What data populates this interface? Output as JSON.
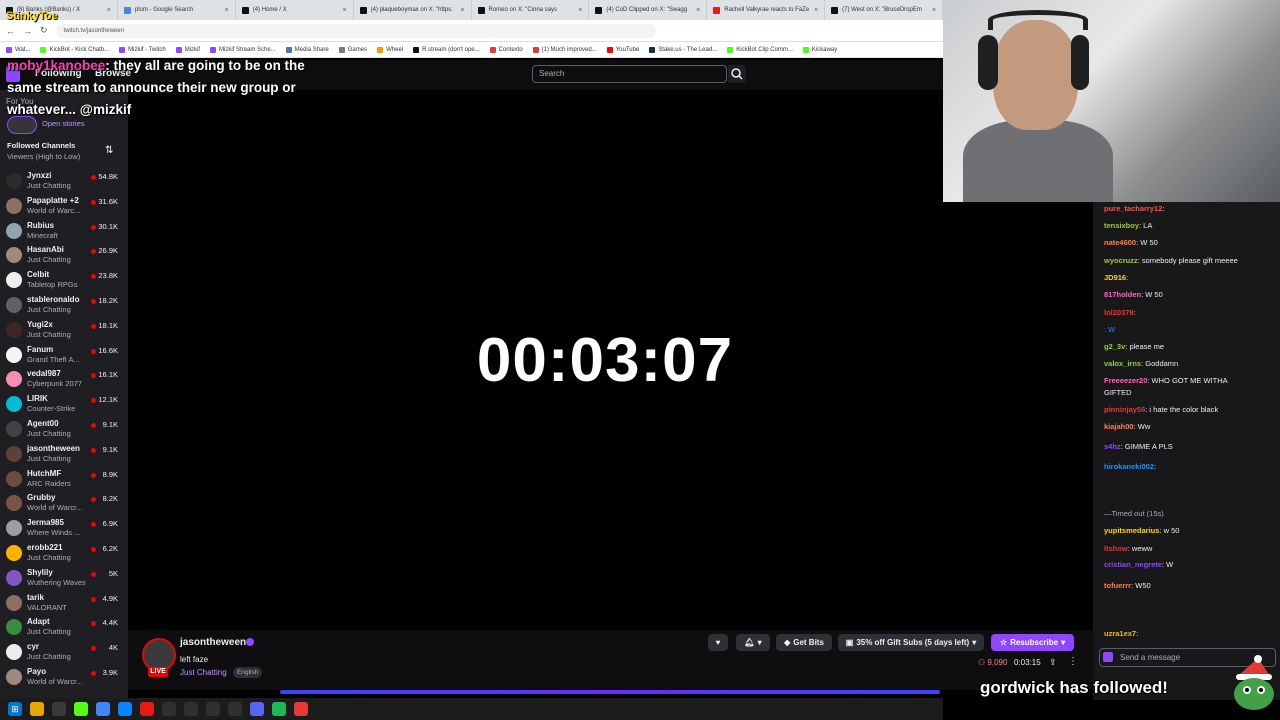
{
  "browser": {
    "tabs": [
      {
        "label": "(8) Banks (@Banks) / X",
        "icon": "x-icon",
        "color": "#111111"
      },
      {
        "label": "plum - Google Search",
        "icon": "google-icon",
        "color": "#4285f4"
      },
      {
        "label": "(4) Home / X",
        "icon": "x-icon",
        "color": "#111111"
      },
      {
        "label": "(4) plaqueboymax on X: \"https:",
        "icon": "x-icon",
        "color": "#111111"
      },
      {
        "label": "Romeo on X: \"Cinna says",
        "icon": "x-icon",
        "color": "#111111"
      },
      {
        "label": "(4) CoD Clipped on X: \"Swagg",
        "icon": "x-icon",
        "color": "#111111"
      },
      {
        "label": "Rachell Valkyrae reacts to FaZe",
        "icon": "video-icon",
        "color": "#e91916"
      },
      {
        "label": "(7) West on X: \"BruceDropEm",
        "icon": "x-icon",
        "color": "#111111"
      }
    ],
    "url": "twitch.tv/jasontheween",
    "bookmarks": [
      {
        "label": "Wat...",
        "color": "#9147ff"
      },
      {
        "label": "KickBot - Kick Chatb...",
        "color": "#53fc18"
      },
      {
        "label": "Mizkif - Twitch",
        "color": "#9147ff"
      },
      {
        "label": "Mizkif",
        "color": "#9147ff"
      },
      {
        "label": "Mizkif Stream Sche...",
        "color": "#9147ff"
      },
      {
        "label": "Media Share",
        "color": "#5c6bc0"
      },
      {
        "label": "Games",
        "color": "#777777"
      },
      {
        "label": "Wheel",
        "color": "#ff9800"
      },
      {
        "label": "R.stream (don't ope...",
        "color": "#111111"
      },
      {
        "label": "Contexto",
        "color": "#e53935"
      },
      {
        "label": "(1) Much improved...",
        "color": "#e53935"
      },
      {
        "label": "YouTube",
        "color": "#ff0000"
      },
      {
        "label": "Stake.us - The Lead...",
        "color": "#1a2c38"
      },
      {
        "label": "KickBot Clip Comm...",
        "color": "#53fc18"
      },
      {
        "label": "Kickaway",
        "color": "#53fc18"
      }
    ]
  },
  "overlay": {
    "streamer_name": "StinkyToe",
    "chat_user": "moby1kanobee",
    "chat_line_1": ": they all are going to be on the",
    "chat_line_2": "same stream to announce their new group or",
    "chat_line_3": "whatever... @mizkif"
  },
  "twitch_nav": {
    "following": "Following",
    "browse": "Browse",
    "search_placeholder": "Search",
    "for_you": "For You"
  },
  "sidebar": {
    "stories": "Open stories",
    "followed_title": "Followed Channels",
    "sort": "Viewers (High to Low)",
    "channels": [
      {
        "name": "Jynxzi",
        "category": "Just Chatting",
        "viewers": "54.8K",
        "color": "#2b2b2b"
      },
      {
        "name": "Papaplatte +2",
        "category": "World of Warc...",
        "viewers": "31.6K",
        "color": "#8d6e63"
      },
      {
        "name": "Rubius",
        "category": "Minecraft",
        "viewers": "30.1K",
        "color": "#90a4ae"
      },
      {
        "name": "HasanAbi",
        "category": "Just Chatting",
        "viewers": "26.9K",
        "color": "#a1887f"
      },
      {
        "name": "Celbit",
        "category": "Tabletop RPGs",
        "viewers": "23.8K",
        "color": "#eeeeee"
      },
      {
        "name": "stableronaldo",
        "category": "Just Chatting",
        "viewers": "18.2K",
        "color": "#616161"
      },
      {
        "name": "Yugi2x",
        "category": "Just Chatting",
        "viewers": "18.1K",
        "color": "#3e2723"
      },
      {
        "name": "Fanum",
        "category": "Grand Theft A...",
        "viewers": "16.6K",
        "color": "#f5f5f5"
      },
      {
        "name": "vedal987",
        "category": "Cyberpunk 2077",
        "viewers": "16.1K",
        "color": "#f48fb1"
      },
      {
        "name": "LIRIK",
        "category": "Counter-Strike",
        "viewers": "12.1K",
        "color": "#00bcd4"
      },
      {
        "name": "Agent00",
        "category": "Just Chatting",
        "viewers": "9.1K",
        "color": "#424242"
      },
      {
        "name": "jasontheween",
        "category": "Just Chatting",
        "viewers": "9.1K",
        "color": "#5d4037"
      },
      {
        "name": "HutchMF",
        "category": "ARC Raiders",
        "viewers": "8.9K",
        "color": "#6d4c41"
      },
      {
        "name": "Grubby",
        "category": "World of Warcr...",
        "viewers": "8.2K",
        "color": "#795548"
      },
      {
        "name": "Jerma985",
        "category": "Where Winds ...",
        "viewers": "6.9K",
        "color": "#9e9e9e"
      },
      {
        "name": "erobb221",
        "category": "Just Chatting",
        "viewers": "6.2K",
        "color": "#ffb300"
      },
      {
        "name": "Shylily",
        "category": "Wuthering Waves",
        "viewers": "5K",
        "color": "#7e57c2"
      },
      {
        "name": "tarik",
        "category": "VALORANT",
        "viewers": "4.9K",
        "color": "#8d6e63"
      },
      {
        "name": "Adapt",
        "category": "Just Chatting",
        "viewers": "4.4K",
        "color": "#388e3c"
      },
      {
        "name": "cyr",
        "category": "Just Chatting",
        "viewers": "4K",
        "color": "#ececec"
      },
      {
        "name": "Payo",
        "category": "World of Warcr...",
        "viewers": "3.9K",
        "color": "#a1887f"
      }
    ]
  },
  "player": {
    "timer": "00:03:07"
  },
  "channel_info": {
    "name": "jasontheween",
    "title": "left faze",
    "category": "Just Chatting",
    "language": "English",
    "live": "LIVE",
    "get_bits": "Get Bits",
    "gift_subs": "35% off Gift Subs (5 days left)",
    "resubscribe": "Resubscribe",
    "viewers": "9,090",
    "uptime": "0:03:15"
  },
  "chat": {
    "input_placeholder": "Send a message",
    "messages": [
      {
        "user": "pure_tacharry12",
        "text": ":",
        "color": "#ff4f4f"
      },
      {
        "user": "tensixboy",
        "text": ": LA",
        "color": "#9acd32"
      },
      {
        "user": "nate4600",
        "text": ": W 50",
        "color": "#ff7f50"
      },
      {
        "user": "wyocruzz",
        "text": ": somebody please gift meeee",
        "color": "#9acd32"
      },
      {
        "user": "JD916",
        "text": ":",
        "color": "#ffd400"
      },
      {
        "user": "817holden",
        "text": ": W 50",
        "color": "#ff69b4"
      },
      {
        "user": "lol20379",
        "text": ":",
        "color": "#e53935"
      },
      {
        "user": "",
        "text": ": W",
        "color": "#1e90ff"
      },
      {
        "user": "g2_3v",
        "text": ": please me",
        "color": "#9acd32"
      },
      {
        "user": "valox_irns",
        "text": ": Goddamn",
        "color": "#9acd32"
      },
      {
        "user": "Freeeezer20",
        "text": ": WHO GOT ME WITHA",
        "color": "#ff69b4"
      },
      {
        "user": "",
        "text": "GIFTED",
        "color": "#efeff1"
      },
      {
        "user": "pinninjay56",
        "text": ": i hate the color black",
        "color": "#e53935"
      },
      {
        "user": "kiajah00",
        "text": ": Ww",
        "color": "#ff7f50"
      },
      {
        "user": "s4hz",
        "text": ": GIMME A PLS",
        "color": "#9147ff"
      },
      {
        "user": "hirokaneki002",
        "text": ":",
        "color": "#1e90ff"
      },
      {
        "user": "",
        "text": "—Timed out (15s)",
        "color": "#adadb8"
      },
      {
        "user": "yupitsmedarius",
        "text": ": w 50",
        "color": "#ffd400"
      },
      {
        "user": "ltshow",
        "text": ": weww",
        "color": "#e53935"
      },
      {
        "user": "cristian_negrete",
        "text": ": W",
        "color": "#9147ff"
      },
      {
        "user": "tofuerrr",
        "text": ": W50",
        "color": "#ff7f50"
      },
      {
        "user": "uzra1ex7",
        "text": ":",
        "color": "#e5c100"
      }
    ]
  },
  "alert": {
    "text": "gordwick has followed!"
  }
}
